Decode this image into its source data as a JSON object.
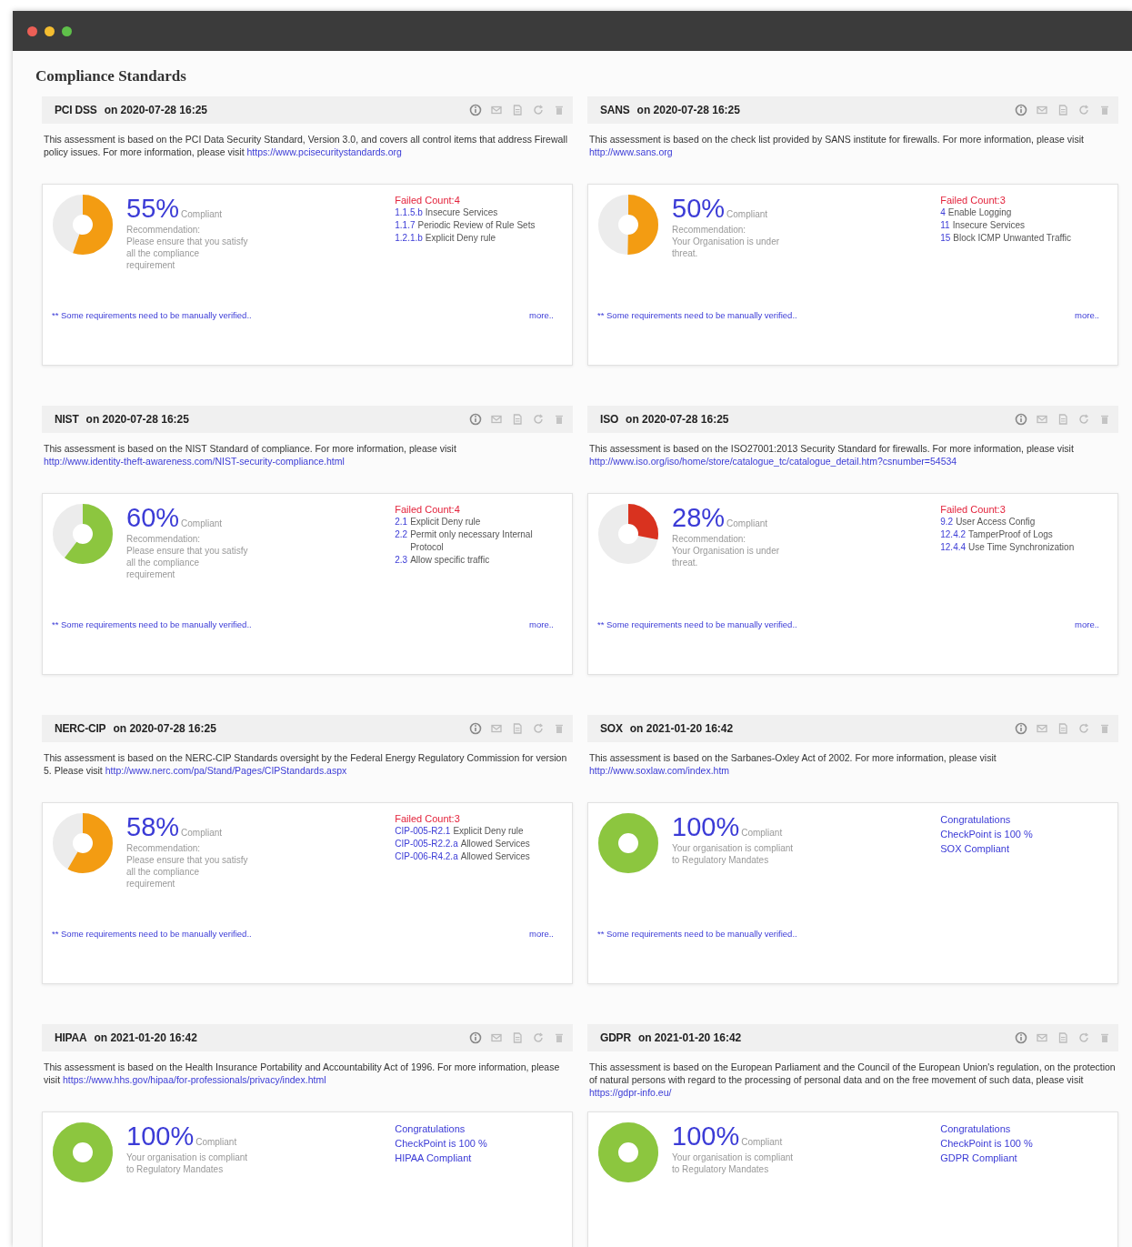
{
  "page_title": "Compliance Standards",
  "standards": [
    {
      "name": "PCI DSS",
      "date": "on 2020-07-28 16:25",
      "description": "This assessment is based on the PCI Data Security Standard, Version 3.0, and covers all control items that address Firewall policy issues. For more information, please visit ",
      "link": "https://www.pcisecuritystandards.org",
      "level": 0.55,
      "color": "#f39c12",
      "percent": "55%",
      "status": "Compliant",
      "recommendation_title": "Recommendation:",
      "recommendation": "Please ensure that you satisfy all the compliance requirement",
      "kind": "failed",
      "failed_count": "Failed Count:4",
      "items": [
        {
          "code": "1.1.5.b",
          "text": "Insecure Services"
        },
        {
          "code": "1.1.7",
          "text": "Periodic Review of Rule Sets"
        },
        {
          "code": "1.2.1.b",
          "text": "Explicit Deny rule"
        }
      ],
      "note": "** Some requirements need to be manually verified..",
      "more": "more.."
    },
    {
      "name": "SANS",
      "date": "on 2020-07-28 16:25",
      "description": "This assessment is based on the check list provided by SANS institute for firewalls. For more information, please visit ",
      "link": "http://www.sans.org",
      "level": 0.5,
      "color": "#f39c12",
      "percent": "50%",
      "status": "Compliant",
      "recommendation_title": "Recommendation:",
      "recommendation": "Your Organisation is under threat.",
      "kind": "failed",
      "failed_count": "Failed Count:3",
      "items": [
        {
          "code": "4",
          "text": "Enable Logging"
        },
        {
          "code": "11",
          "text": "Insecure Services"
        },
        {
          "code": "15",
          "text": "Block ICMP Unwanted Traffic"
        }
      ],
      "note": "** Some requirements need to be manually verified..",
      "more": "more.."
    },
    {
      "name": "NIST",
      "date": "on 2020-07-28 16:25",
      "description": "This assessment is based on the NIST Standard of compliance. For more information, please visit ",
      "link": "http://www.identity-theft-awareness.com/NIST-security-compliance.html",
      "level": 0.6,
      "color": "#8cc63f",
      "percent": "60%",
      "status": "Compliant",
      "recommendation_title": "Recommendation:",
      "recommendation": "Please ensure that you satisfy all the compliance requirement",
      "kind": "failed",
      "failed_count": "Failed Count:4",
      "items": [
        {
          "code": "2.1",
          "text": "Explicit Deny rule"
        },
        {
          "code": "2.2",
          "text": "Permit only necessary Internal Protocol"
        },
        {
          "code": "2.3",
          "text": "Allow specific traffic"
        }
      ],
      "note": "** Some requirements need to be manually verified..",
      "more": "more.."
    },
    {
      "name": "ISO",
      "date": "on 2020-07-28 16:25",
      "description": "This assessment is based on the ISO27001:2013 Security Standard for firewalls. For more information, please visit ",
      "link": "http://www.iso.org/iso/home/store/catalogue_tc/catalogue_detail.htm?csnumber=54534",
      "level": 0.28,
      "color": "#d9321f",
      "percent": "28%",
      "status": "Compliant",
      "recommendation_title": "Recommendation:",
      "recommendation": "Your Organisation is under threat.",
      "kind": "failed",
      "failed_count": "Failed Count:3",
      "items": [
        {
          "code": "9.2",
          "text": "User Access Config"
        },
        {
          "code": "12.4.2",
          "text": "TamperProof of Logs"
        },
        {
          "code": "12.4.4",
          "text": "Use Time Synchronization"
        }
      ],
      "note": "** Some requirements need to be manually verified..",
      "more": "more.."
    },
    {
      "name": "NERC-CIP",
      "date": "on 2020-07-28 16:25",
      "description": "This assessment is based on the NERC-CIP Standards oversight by the Federal Energy Regulatory Commission for version 5. Please visit ",
      "link": "http://www.nerc.com/pa/Stand/Pages/CIPStandards.aspx",
      "level": 0.58,
      "color": "#f39c12",
      "percent": "58%",
      "status": "Compliant",
      "recommendation_title": "Recommendation:",
      "recommendation": "Please ensure that you satisfy all the compliance requirement",
      "kind": "failed",
      "failed_count": "Failed Count:3",
      "items": [
        {
          "code": "CIP-005-R2.1",
          "text": "Explicit Deny rule"
        },
        {
          "code": "CIP-005-R2.2.a",
          "text": "Allowed Services"
        },
        {
          "code": "CIP-006-R4.2.a",
          "text": "Allowed Services"
        }
      ],
      "note": "** Some requirements need to be manually verified..",
      "more": "more.."
    },
    {
      "name": "SOX",
      "date": "on 2021-01-20 16:42",
      "description": "This assessment is based on the Sarbanes-Oxley Act of 2002. For more information, please visit ",
      "link": "http://www.soxlaw.com/index.htm",
      "level": 1,
      "color": "#8cc63f",
      "percent": "100%",
      "status": "Compliant",
      "recommendation": "Your organisation is compliant to Regulatory Mandates",
      "kind": "passed",
      "messages": [
        "Congratulations",
        "CheckPoint is 100 %",
        "SOX Compliant"
      ],
      "note": "** Some requirements need to be manually verified.."
    },
    {
      "name": "HIPAA",
      "date": "on 2021-01-20 16:42",
      "description": "This assessment is based on the Health Insurance Portability and Accountability Act of 1996. For more information, please visit ",
      "link": "https://www.hhs.gov/hipaa/for-professionals/privacy/index.html",
      "level": 1,
      "color": "#8cc63f",
      "percent": "100%",
      "status": "Compliant",
      "recommendation": "Your organisation is compliant to Regulatory Mandates",
      "kind": "passed",
      "messages": [
        "Congratulations",
        "CheckPoint is 100 %",
        "HIPAA Compliant"
      ]
    },
    {
      "name": "GDPR",
      "date": "on 2021-01-20 16:42",
      "description": "This assessment is based on the European Parliament and the Council of the European Union's regulation, on the protection of natural persons with regard to the processing of personal data and on the free movement of such data, please visit ",
      "link": "https://gdpr-info.eu/",
      "level": 1,
      "color": "#8cc63f",
      "percent": "100%",
      "status": "Compliant",
      "recommendation": "Your organisation is compliant to Regulatory Mandates",
      "kind": "passed",
      "messages": [
        "Congratulations",
        "CheckPoint is 100 %",
        "GDPR Compliant"
      ]
    }
  ]
}
